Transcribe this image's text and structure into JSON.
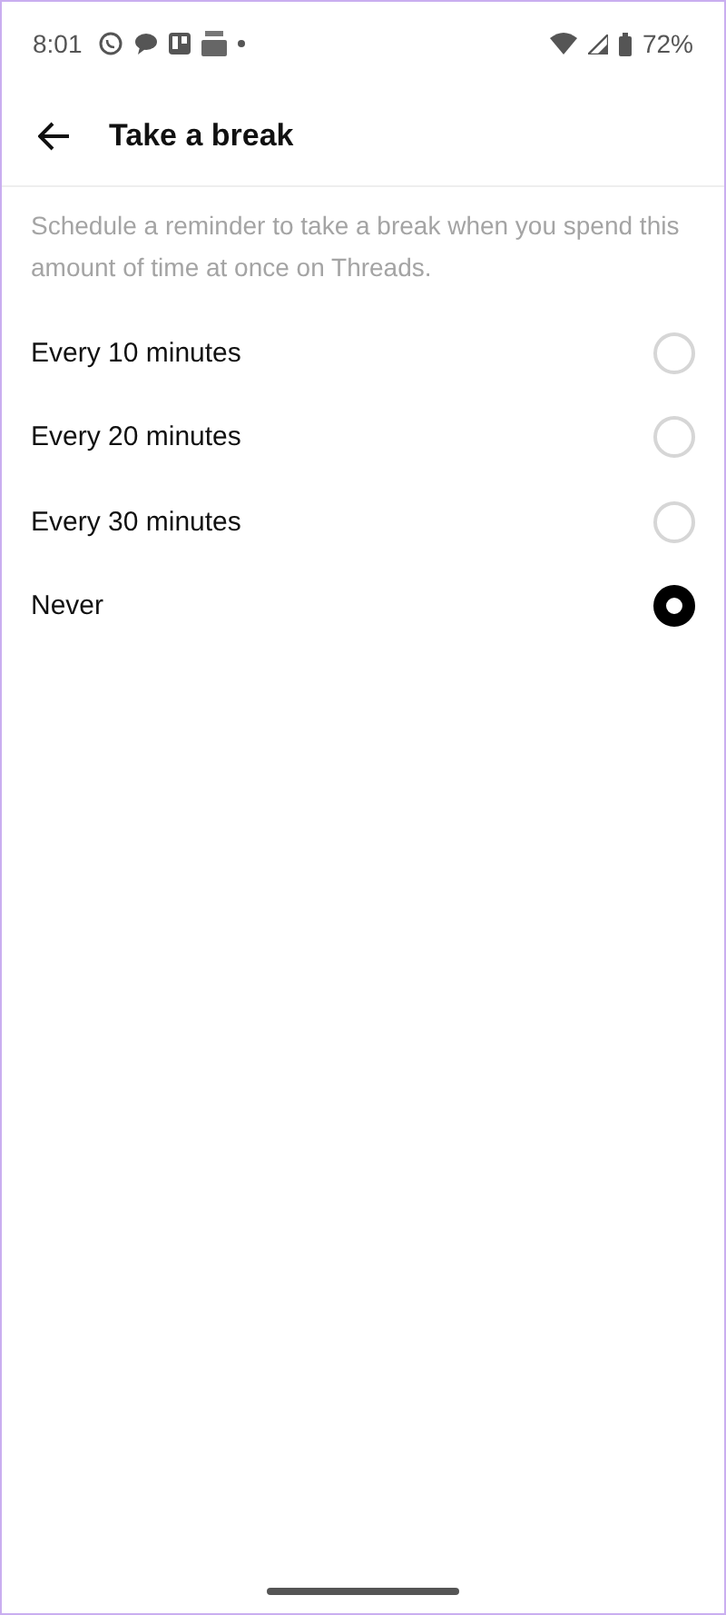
{
  "status_bar": {
    "time": "8:01",
    "battery": "72%"
  },
  "header": {
    "title": "Take a break"
  },
  "description": "Schedule a reminder to take a break when you spend this amount of time at once on Threads.",
  "options": [
    {
      "label": "Every 10 minutes",
      "selected": false
    },
    {
      "label": "Every 20 minutes",
      "selected": false
    },
    {
      "label": "Every 30 minutes",
      "selected": false
    },
    {
      "label": "Never",
      "selected": true
    }
  ]
}
